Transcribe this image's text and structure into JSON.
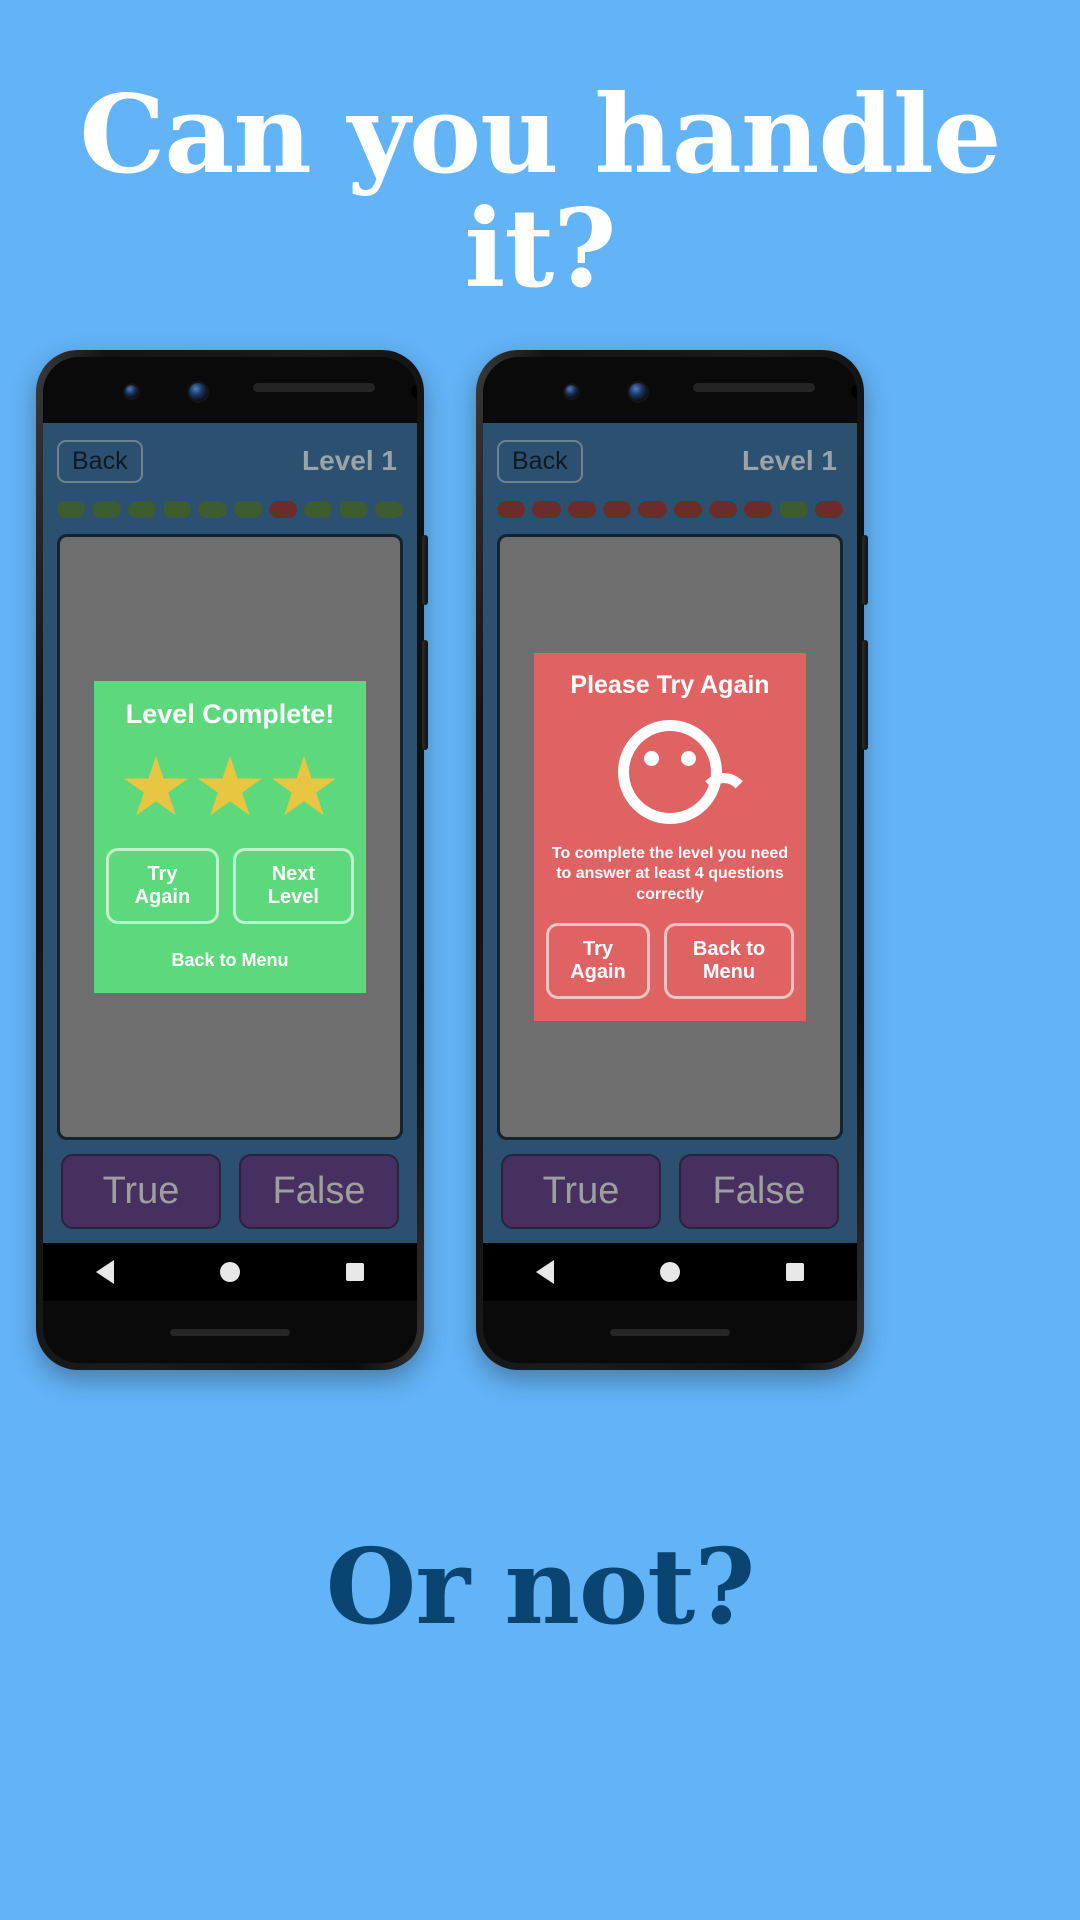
{
  "promo": {
    "headline_top": "Can you handle it?",
    "headline_bottom": "Or not?",
    "background_color": "#63b3f7",
    "headline_top_color": "#ffffff",
    "headline_bottom_color": "#0a4471"
  },
  "phones": [
    {
      "id": "left",
      "topbar": {
        "back_label": "Back",
        "level_label": "Level 1"
      },
      "progress_dots": [
        "green",
        "green",
        "green",
        "green",
        "green",
        "green",
        "red",
        "green",
        "green",
        "green"
      ],
      "dialog": {
        "type": "success",
        "title": "Level Complete!",
        "stars": 3,
        "star_color": "#e8c642",
        "panel_color": "#5ed87c",
        "buttons": [
          {
            "label": "Try Again"
          },
          {
            "label": "Next Level"
          }
        ],
        "link_label": "Back to Menu"
      },
      "answer_buttons": [
        {
          "label": "True"
        },
        {
          "label": "False"
        }
      ],
      "navbar": [
        "back-triangle-icon",
        "home-circle-icon",
        "recents-square-icon"
      ]
    },
    {
      "id": "right",
      "topbar": {
        "back_label": "Back",
        "level_label": "Level 1"
      },
      "progress_dots": [
        "red",
        "red",
        "red",
        "red",
        "red",
        "red",
        "red",
        "red",
        "green",
        "red"
      ],
      "dialog": {
        "type": "fail",
        "title": "Please Try Again",
        "icon": "sad-face-icon",
        "panel_color": "#e06364",
        "body_text": "To complete the level you need to answer at least 4 questions correctly",
        "buttons": [
          {
            "label": "Try Again"
          },
          {
            "label": "Back to Menu"
          }
        ]
      },
      "answer_buttons": [
        {
          "label": "True"
        },
        {
          "label": "False"
        }
      ],
      "navbar": [
        "back-triangle-icon",
        "home-circle-icon",
        "recents-square-icon"
      ]
    }
  ],
  "theme": {
    "screen_bg": "#2b5070",
    "card_bg": "#6e6e6e",
    "answer_btn_bg": "#46305f",
    "answer_btn_text": "#9f9f9f",
    "dot_green": "#3c5c31",
    "dot_red": "#6d2c2c"
  }
}
